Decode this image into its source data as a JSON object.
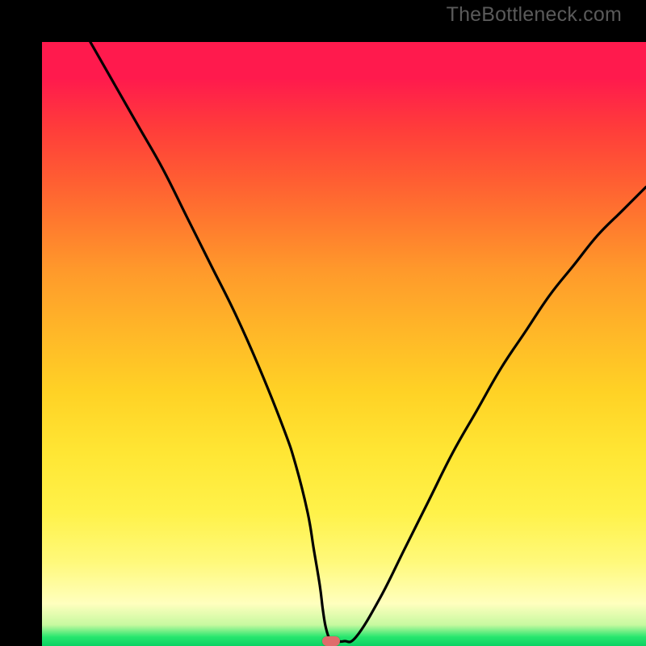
{
  "watermark": "TheBottleneck.com",
  "chart_data": {
    "type": "line",
    "title": "",
    "xlabel": "",
    "ylabel": "",
    "xlim": [
      0,
      100
    ],
    "ylim": [
      0,
      100
    ],
    "grid": false,
    "background": "rainbow-gradient-red-to-green",
    "series": [
      {
        "name": "bottleneck-curve",
        "x": [
          8,
          12,
          16,
          20,
          24,
          28,
          32,
          36,
          40,
          42,
          44,
          45,
          46,
          46.5,
          47,
          47.7,
          48.5,
          50,
          52,
          56,
          60,
          64,
          68,
          72,
          76,
          80,
          84,
          88,
          92,
          96,
          100
        ],
        "y": [
          100,
          93,
          86,
          79,
          71,
          63,
          55,
          46,
          36,
          30,
          22,
          16,
          10,
          6,
          3,
          1,
          0.8,
          0.8,
          1.5,
          8,
          16,
          24,
          32,
          39,
          46,
          52,
          58,
          63,
          68,
          72,
          76
        ]
      }
    ],
    "marker": {
      "x": 47.8,
      "y": 0.8,
      "color": "#e06b6b"
    },
    "gradient_stops": [
      {
        "pos": 0.0,
        "color": "#ff1a4d"
      },
      {
        "pos": 0.3,
        "color": "#ff7a2e"
      },
      {
        "pos": 0.58,
        "color": "#ffd225"
      },
      {
        "pos": 0.86,
        "color": "#fff97a"
      },
      {
        "pos": 0.965,
        "color": "#c7f9a0"
      },
      {
        "pos": 1.0,
        "color": "#0bd063"
      }
    ]
  }
}
